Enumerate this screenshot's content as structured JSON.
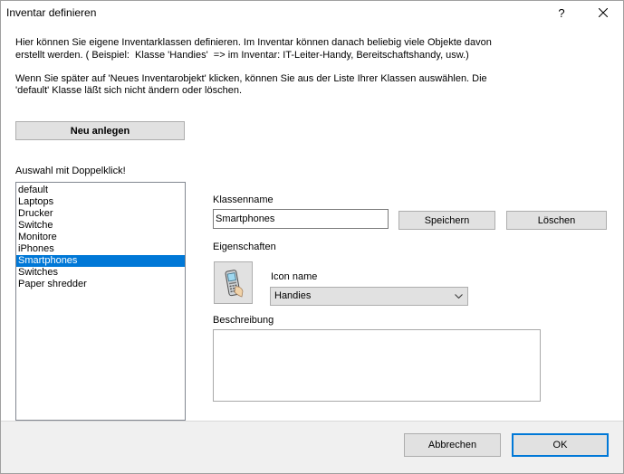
{
  "window": {
    "title": "Inventar definieren",
    "help_label": "?"
  },
  "icons": {
    "close": "close-icon",
    "class_icon": "mobile-phone-icon",
    "dropdown_arrow": "chevron-down-icon"
  },
  "intro": {
    "paragraph_1": [
      "Hier können Sie eigene Inventarklassen definieren. Im Inventar können danach beliebig viele Objekte davon",
      "erstellt werden. ( Beispiel:  Klasse 'Handies'  => im Inventar: IT-Leiter-Handy, Bereitschaftshandy, usw.)"
    ],
    "paragraph_2": [
      "Wenn Sie später auf 'Neues Inventarobjekt' klicken, können Sie aus der Liste Ihrer Klassen auswählen. Die",
      "'default' Klasse läßt sich nicht ändern oder löschen."
    ]
  },
  "new_button_label": "Neu anlegen",
  "class_list": {
    "label": "Auswahl mit Doppelklick!",
    "items": [
      {
        "label": "default"
      },
      {
        "label": "Laptops"
      },
      {
        "label": "Drucker"
      },
      {
        "label": "Switche"
      },
      {
        "label": "Monitore"
      },
      {
        "label": "iPhones"
      },
      {
        "label": "Smartphones",
        "selected": true
      },
      {
        "label": "Switches"
      },
      {
        "label": "Paper shredder"
      }
    ]
  },
  "class_form": {
    "name_label": "Klassenname",
    "name_value": "Smartphones",
    "save_label": "Speichern",
    "delete_label": "Löschen",
    "properties_label": "Eigenschaften",
    "icon_name_label": "Icon name",
    "icon_name_selected": "Handies",
    "description_label": "Beschreibung",
    "description_value": ""
  },
  "footer": {
    "cancel_label": "Abbrechen",
    "ok_label": "OK"
  },
  "colors": {
    "selection": "#0078d7",
    "selection_text": "#ffffff",
    "button_face": "#e1e1e1",
    "button_border": "#adadad",
    "default_button_border": "#0078d7",
    "footer_background": "#f0f0f0",
    "window_background": "#ffffff"
  }
}
